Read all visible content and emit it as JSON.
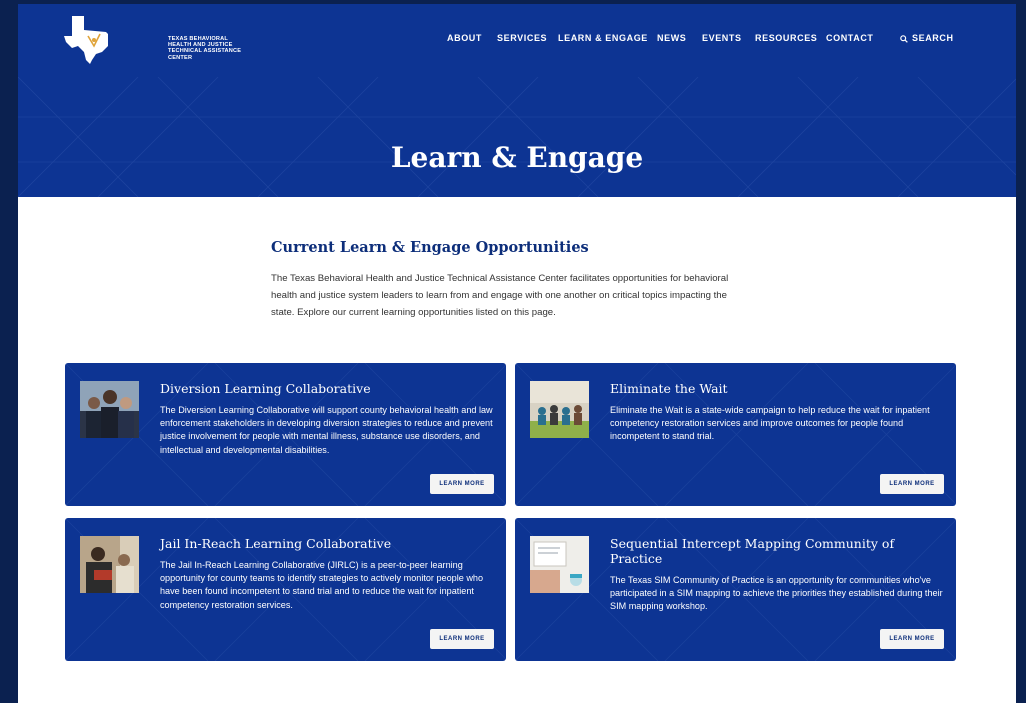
{
  "header": {
    "logo_lines": [
      "Texas Behavioral",
      "Health and Justice",
      "Technical Assistance",
      "Center"
    ],
    "nav": [
      {
        "label": "ABOUT"
      },
      {
        "label": "SERVICES"
      },
      {
        "label": "LEARN & ENGAGE"
      },
      {
        "label": "NEWS"
      },
      {
        "label": "EVENTS"
      },
      {
        "label": "RESOURCES"
      },
      {
        "label": "CONTACT"
      },
      {
        "label": "SEARCH",
        "icon": "search-icon"
      }
    ]
  },
  "banner": {
    "title": "Learn & Engage"
  },
  "intro": {
    "heading": "Current Learn & Engage Opportunities",
    "text": "The Texas Behavioral Health and Justice Technical Assistance Center facilitates opportunities for behavioral health and justice system leaders to learn from and engage with one another on critical topics impacting the state. Explore our current learning opportunities listed on this page."
  },
  "cards": [
    {
      "title": "Diversion Learning Collaborative",
      "description": "The Diversion Learning Collaborative will support county behavioral health and law enforcement stakeholders in developing diversion strategies to reduce and prevent justice involvement for people with mental illness, substance use disorders, and intellectual and developmental disabilities.",
      "button": "LEARN MORE"
    },
    {
      "title": "Eliminate the Wait",
      "description": "Eliminate the Wait is a state-wide campaign to help reduce the wait for inpatient competency restoration services and improve outcomes for people found incompetent to stand trial.",
      "button": "LEARN MORE"
    },
    {
      "title": "Jail In-Reach Learning Collaborative",
      "description": "The Jail In-Reach Learning Collaborative (JIRLC) is a peer-to-peer learning opportunity for county teams to identify strategies to actively monitor people who have been found incompetent to stand trial and to reduce the wait for inpatient competency restoration services.",
      "button": "LEARN MORE"
    },
    {
      "title": "Sequential Intercept Mapping Community of Practice",
      "description": "The Texas SIM Community of Practice is an opportunity for communities who've participated in a SIM mapping to achieve the priorities they established during their SIM mapping workshop.",
      "button": "LEARN MORE"
    }
  ],
  "colors": {
    "brand_blue": "#0d3493",
    "page_bg": "#0b2150",
    "heading": "#0d2e7a"
  }
}
